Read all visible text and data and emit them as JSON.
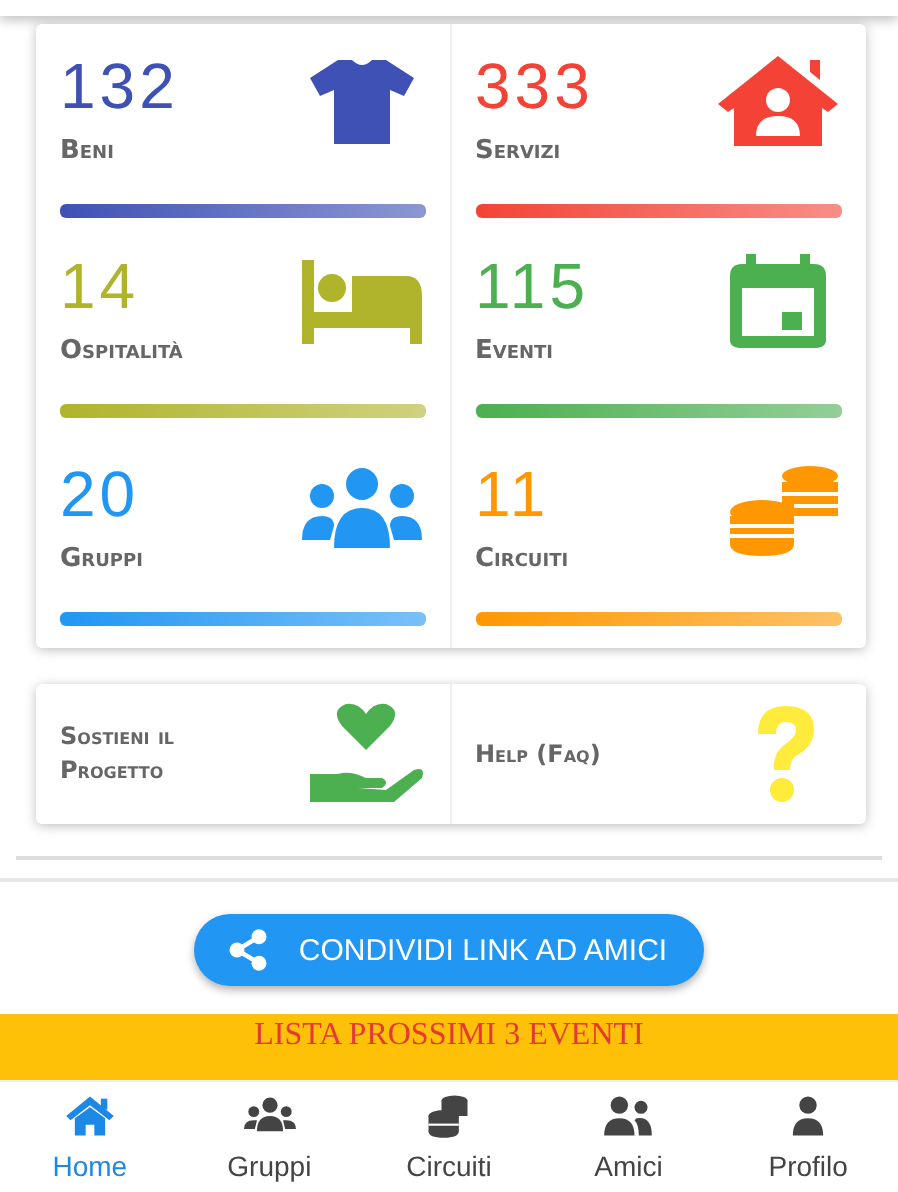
{
  "stats": [
    {
      "value": "132",
      "label": "Beni",
      "color": "#3f51b5"
    },
    {
      "value": "333",
      "label": "Servizi",
      "color": "#f44336"
    },
    {
      "value": "14",
      "label": "Ospitalità",
      "color": "#afb42b"
    },
    {
      "value": "115",
      "label": "Eventi",
      "color": "#4caf50"
    },
    {
      "value": "20",
      "label": "Gruppi",
      "color": "#2196f3"
    },
    {
      "value": "11",
      "label": "Circuiti",
      "color": "#ff9800"
    }
  ],
  "links": [
    {
      "label": "Sostieni il Progetto"
    },
    {
      "label": "Help (Faq)"
    }
  ],
  "share_button": "CONDIVIDI LINK AD AMICI",
  "banner": "LISTA PROSSIMI 3 EVENTI",
  "nav": [
    {
      "label": "Home",
      "selected": true
    },
    {
      "label": "Gruppi",
      "selected": false
    },
    {
      "label": "Circuiti",
      "selected": false
    },
    {
      "label": "Amici",
      "selected": false
    },
    {
      "label": "Profilo",
      "selected": false
    }
  ]
}
